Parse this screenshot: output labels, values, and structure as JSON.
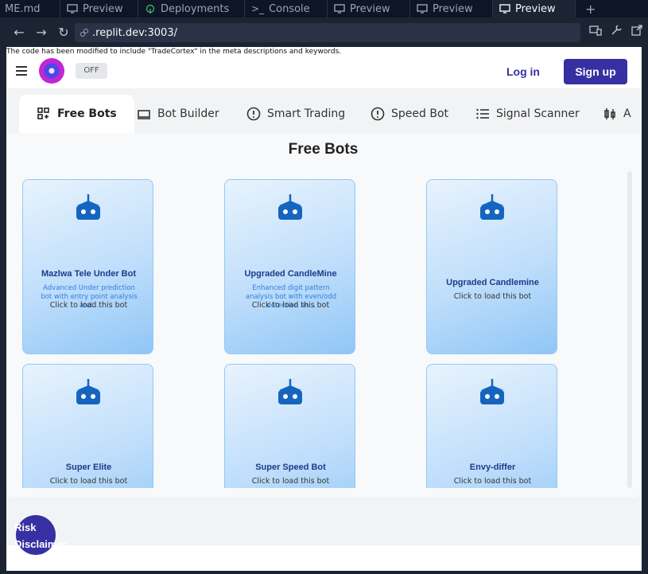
{
  "ide": {
    "tabs": [
      {
        "label": "ME.md",
        "icon": "file-icon",
        "active": false
      },
      {
        "label": "Preview",
        "icon": "monitor-icon",
        "active": false
      },
      {
        "label": "Deployments",
        "icon": "deploy-icon",
        "active": false
      },
      {
        "label": "Console",
        "icon": "terminal-icon",
        "active": false
      },
      {
        "label": "Preview",
        "icon": "monitor-icon",
        "active": false
      },
      {
        "label": "Preview",
        "icon": "monitor-icon",
        "active": false
      },
      {
        "label": "Preview",
        "icon": "monitor-icon",
        "active": true
      }
    ],
    "new_tab": "+",
    "url_host_suffix": ".replit.dev:3003/"
  },
  "page": {
    "notice": "The code has been modified to include \"TradeCortex\" in the meta descriptions and keywords.",
    "toggle_label": "OFF",
    "login_label": "Log in",
    "signup_label": "Sign up",
    "tabs": [
      {
        "label": "Free Bots",
        "icon": "grid-icon",
        "active": true
      },
      {
        "label": "Bot Builder",
        "icon": "builder-icon",
        "active": false
      },
      {
        "label": "Smart Trading",
        "icon": "alert-circle-icon",
        "active": false
      },
      {
        "label": "Speed Bot",
        "icon": "alert-circle-icon",
        "active": false
      },
      {
        "label": "Signal Scanner",
        "icon": "list-icon",
        "active": false
      },
      {
        "label": "A",
        "icon": "candles-icon",
        "active": false
      }
    ],
    "panel_title": "Free Bots",
    "cards": [
      {
        "title": "Mazlwa Tele Under Bot",
        "desc": "Advanced Under prediction bot with entry point analysis and...",
        "hint": "Click to load this bot"
      },
      {
        "title": "Upgraded CandleMine",
        "desc": "Enhanced digit pattern analysis bot with even/odd detection an...",
        "hint": "Click to load this bot"
      },
      {
        "title": "Upgraded Candlemine",
        "desc": "",
        "hint": "Click to load this bot"
      },
      {
        "title": "Super Elite",
        "desc": "",
        "hint": "Click to load this bot"
      },
      {
        "title": "Super Speed Bot",
        "desc": "",
        "hint": "Click to load this bot"
      },
      {
        "title": "Envy-differ",
        "desc": "",
        "hint": "Click to load this bot"
      }
    ],
    "risk_label": "Risk Disclaimer"
  },
  "colors": {
    "accent": "#3730a3",
    "card_border": "#90caf9",
    "bot_icon": "#1565c0"
  }
}
